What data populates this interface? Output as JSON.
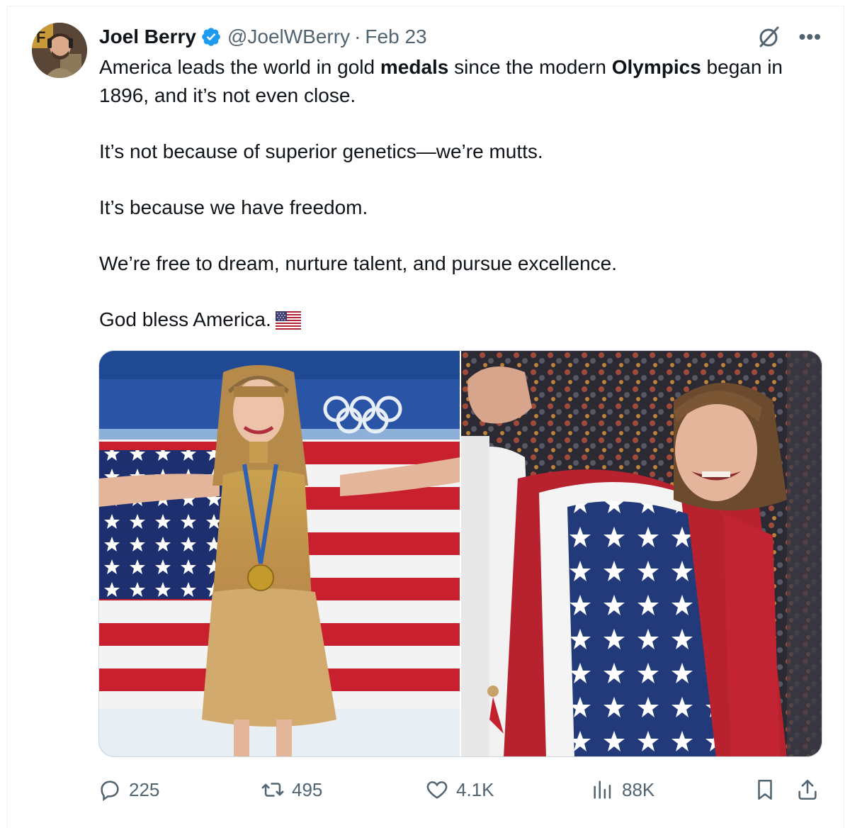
{
  "tweet": {
    "author_name": "Joel Berry",
    "handle": "@JoelWBerry",
    "separator": "·",
    "date": "Feb 23",
    "more_label": "•••",
    "verified": true,
    "text": {
      "p1_a": "America leads the world in gold ",
      "p1_b": "medals",
      "p1_c": " since the modern ",
      "p1_d": "Olympics",
      "p1_e": " began in 1896, and it’s not even close.",
      "p2": "It’s not because of superior genetics—we’re mutts.",
      "p3": "It’s because we have freedom.",
      "p4": "We’re free to dream, nurture talent, and pursue excellence.",
      "p5": "God bless America."
    },
    "media": [
      {
        "name": "figure-skater-with-flag"
      },
      {
        "name": "hockey-player-with-flag"
      }
    ],
    "actions": {
      "replies": "225",
      "reposts": "495",
      "likes": "4.1K",
      "views": "88K"
    }
  },
  "colors": {
    "text": "#0f1419",
    "secondary": "#536471",
    "verified_blue": "#1d9bf0",
    "border": "#cfd9de"
  }
}
